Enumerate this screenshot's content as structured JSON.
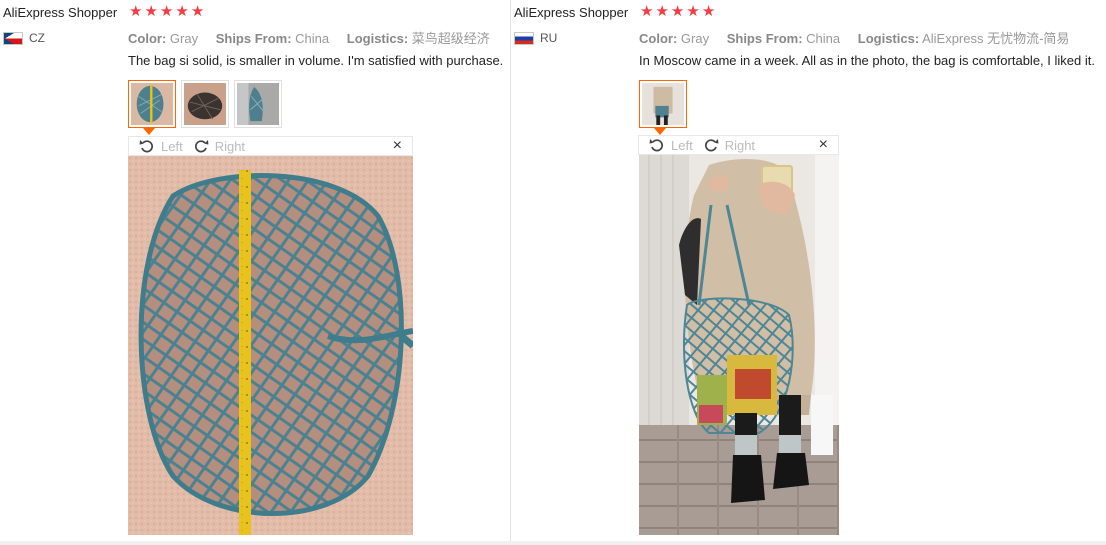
{
  "reviews": [
    {
      "author": "AliExpress Shopper",
      "country": "CZ",
      "flag": "czech-flag",
      "rating": 5,
      "attributes": [
        {
          "label": "Color:",
          "value": "Gray"
        },
        {
          "label": "Ships From:",
          "value": "China"
        },
        {
          "label": "Logistics:",
          "value": "菜鸟超级经济"
        }
      ],
      "text": "The bag si solid, is smaller in volume. I'm satisfied with purchase.",
      "thumbnails": [
        "bag-with-tape-measure-photo",
        "dark-bag-on-floor-photo",
        "bag-on-arm-photo"
      ],
      "viewer": {
        "rotate_left": "Left",
        "rotate_right": "Right",
        "close": "×"
      }
    },
    {
      "author": "AliExpress Shopper",
      "country": "RU",
      "flag": "russian-flag",
      "rating": 5,
      "attributes": [
        {
          "label": "Color:",
          "value": "Gray"
        },
        {
          "label": "Ships From:",
          "value": "China"
        },
        {
          "label": "Logistics:",
          "value": "AliExpress 无忧物流-简易"
        }
      ],
      "text": "In Moscow came in a week. All as in the photo, the bag is comfortable, I liked it.",
      "thumbnails": [
        "mirror-selfie-with-bag-photo"
      ],
      "viewer": {
        "rotate_left": "Left",
        "rotate_right": "Right",
        "close": "×"
      }
    }
  ],
  "colors": {
    "star": "#f23d44",
    "active_thumb_border": "#ff6600",
    "bag_mesh": "#3f7d8c",
    "tape_measure": "#e8c31c"
  }
}
